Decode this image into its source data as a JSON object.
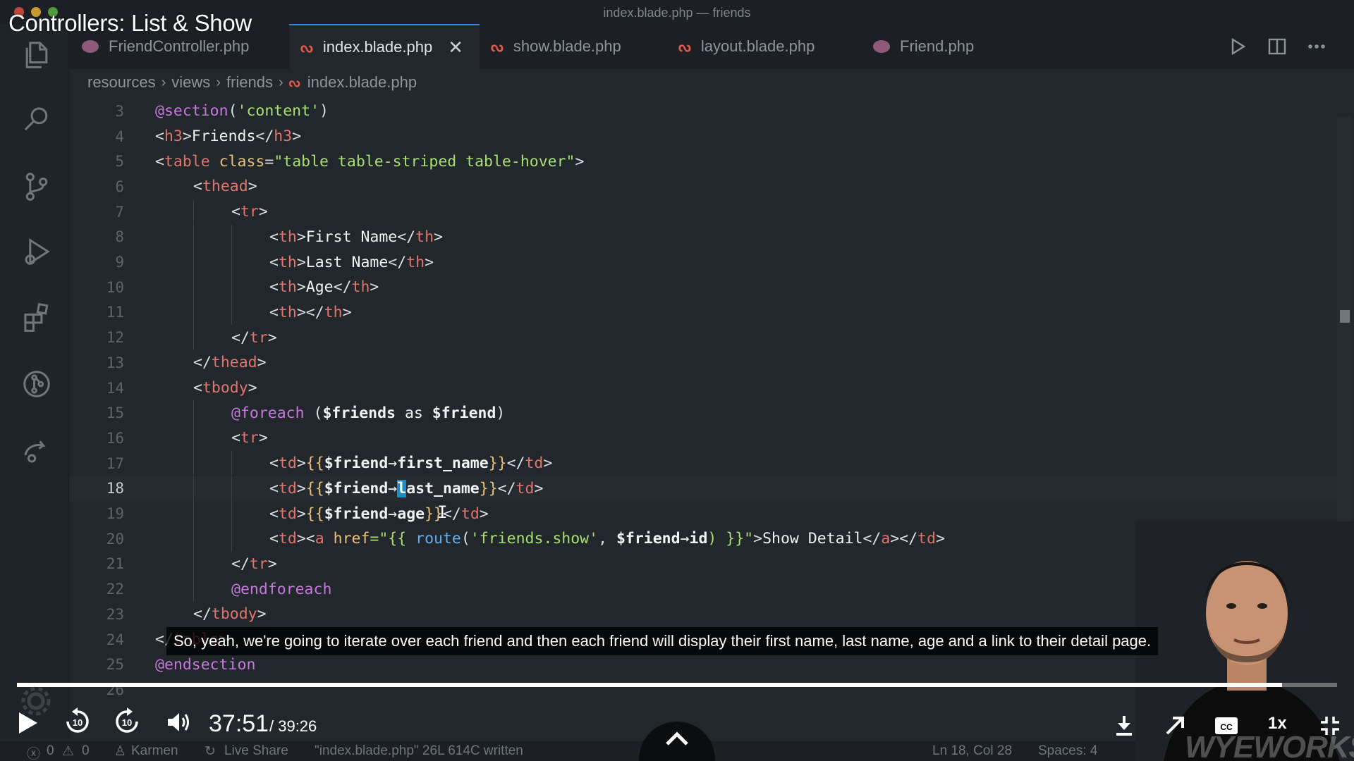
{
  "video": {
    "title": "Controllers: List & Show",
    "subtitle": "So, yeah, we're going to iterate over each friend and then each friend will display their first name, last name, age and a link to their detail page.",
    "time_current": "37:51",
    "time_total": "/ 39:26",
    "speed": "1x",
    "progress": 0.9586,
    "watermark": "WYEWORKS"
  },
  "window": {
    "title": "index.blade.php — friends"
  },
  "tabs": [
    {
      "label": "FriendController.php",
      "icon": "php-elephant-icon",
      "active": false
    },
    {
      "label": "index.blade.php",
      "icon": "blade-icon",
      "active": true
    },
    {
      "label": "show.blade.php",
      "icon": "blade-icon",
      "active": false
    },
    {
      "label": "layout.blade.php",
      "icon": "blade-icon",
      "active": false
    },
    {
      "label": "Friend.php",
      "icon": "php-elephant-icon",
      "active": false
    }
  ],
  "breadcrumb": [
    "resources",
    "views",
    "friends",
    "index.blade.php"
  ],
  "editor": {
    "current_line": 18,
    "lines": [
      {
        "n": "3"
      },
      {
        "n": "4"
      },
      {
        "n": "5"
      },
      {
        "n": "6"
      },
      {
        "n": "7"
      },
      {
        "n": "8"
      },
      {
        "n": "9"
      },
      {
        "n": "10"
      },
      {
        "n": "11"
      },
      {
        "n": "12"
      },
      {
        "n": "13"
      },
      {
        "n": "14"
      },
      {
        "n": "15"
      },
      {
        "n": "16"
      },
      {
        "n": "17"
      },
      {
        "n": "18"
      },
      {
        "n": "19"
      },
      {
        "n": "20"
      },
      {
        "n": "21"
      },
      {
        "n": "22"
      },
      {
        "n": "23"
      },
      {
        "n": "24"
      },
      {
        "n": "25"
      },
      {
        "n": "26"
      }
    ],
    "code": {
      "l3_dir": "@section",
      "l3_arg": "'content'",
      "l4_tag": "h3",
      "l4_text": "Friends",
      "l5_tag": "table",
      "l5_attr": "class",
      "l5_val": "\"table table-striped table-hover\"",
      "thead": "thead",
      "tr": "tr",
      "th": "th",
      "td": "td",
      "a": "a",
      "tbody": "tbody",
      "th_first": "First Name",
      "th_last": "Last Name",
      "th_age": "Age",
      "foreach": "@foreach",
      "foreach_open": " (",
      "friends_var": "$friends",
      "as": " as ",
      "friend_var": "$friend",
      "foreach_close": ")",
      "open_echo": "{{",
      "close_echo": "}}",
      "arrow": "→",
      "first_name": "first_name",
      "last_name_first": "l",
      "last_name_rest": "ast_name",
      "age": "age",
      "href_attr": "href",
      "href_open": "=\"{{ ",
      "route_fn": "route",
      "route_arg": "'friends.show'",
      "route_mid": ", ",
      "id": "id",
      "route_close": ") }}\"",
      "show_detail": "Show Detail",
      "endforeach": "@endforeach",
      "endsection": "@endsection"
    }
  },
  "statusbar": {
    "errors": "0",
    "warnings": "0",
    "user": "Karmen",
    "live_share": "Live Share",
    "message": "\"index.blade.php\" 26L 614C written",
    "position": "Ln 18, Col 28",
    "spaces": "Spaces: 4"
  }
}
